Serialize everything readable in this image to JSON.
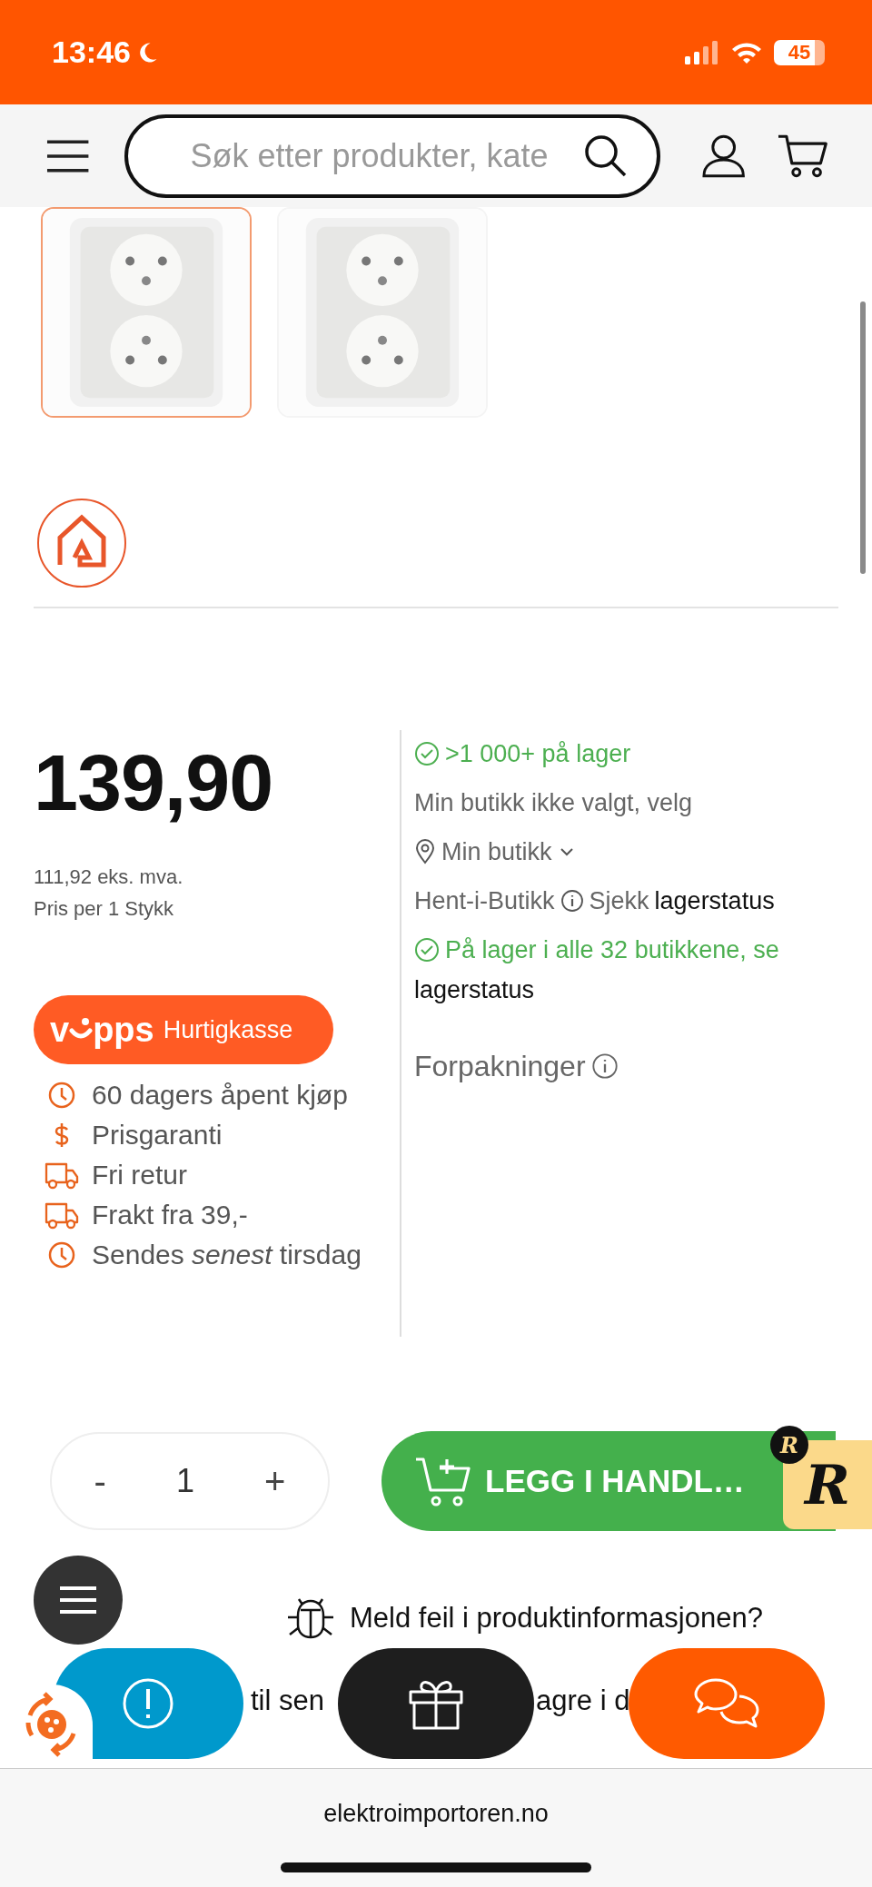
{
  "status_bar": {
    "time": "13:46",
    "battery": "45"
  },
  "header": {
    "search": {
      "placeholder": "Søk etter produkter, kate"
    }
  },
  "thumbnails": [
    {
      "selected": true
    },
    {
      "selected": false
    }
  ],
  "price": {
    "amount": "139,90",
    "ex_vat": "111,92 eks. mva.",
    "unit": "Pris per 1 Stykk"
  },
  "vipps": {
    "logo_parts": [
      "v",
      "pps"
    ],
    "label": "Hurtigkasse"
  },
  "perks": [
    {
      "kind": "clock",
      "text": "60 dagers åpent kjøp"
    },
    {
      "kind": "dollar",
      "text": "Prisgaranti"
    },
    {
      "kind": "truck",
      "text": "Fri retur"
    },
    {
      "kind": "truck",
      "text": "Frakt fra 39,-"
    },
    {
      "kind": "clock",
      "text": "Sendes *senest* tirsdag"
    }
  ],
  "stock": {
    "online": ">1 000+ på lager",
    "store_note": "Min butikk ikke valgt, velg",
    "store_select": "Min butikk",
    "pickup": "Hent-i-Butikk",
    "check": "Sjekk",
    "check_link": "lagerstatus",
    "all_stores": "På lager i alle 32 butikkene, se",
    "all_stores_link": "lagerstatus",
    "packaging": "Forpakninger"
  },
  "quantity": {
    "minus": "-",
    "value": "1",
    "plus": "+"
  },
  "add_to_cart": "LEGG I HANDL…",
  "badge_letters": [
    "R",
    "R"
  ],
  "report_link": "Meld feil i produktinformasjonen?",
  "covered_text": [
    "til sen",
    "agre i d"
  ],
  "footer": {
    "url": "elektroimportoren.no"
  }
}
